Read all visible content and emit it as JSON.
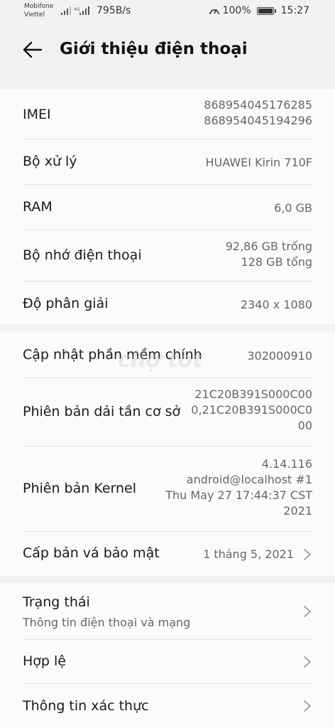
{
  "status_bar": {
    "carrier1": "Mobifone",
    "carrier2": "Viettel",
    "net_speed": "795B/s",
    "battery": "100%",
    "time": "15:27"
  },
  "header": {
    "title": "Giới thiệu điện thoại"
  },
  "section1": {
    "imei_label": "IMEI",
    "imei_value1": "868954045176285",
    "imei_value2": "868954045194296",
    "cpu_label": "Bộ xử lý",
    "cpu_value": "HUAWEI Kirin 710F",
    "ram_label": "RAM",
    "ram_value": "6,0 GB",
    "storage_label": "Bộ nhớ điện thoại",
    "storage_value1": "92,86  GB trống",
    "storage_value2": "128  GB tổng",
    "resolution_label": "Độ phân giải",
    "resolution_value": "2340 x 1080"
  },
  "section2": {
    "software_label": "Cập nhật phần mềm chính",
    "software_value": "302000910",
    "baseband_label": "Phiên bản dải tần cơ sở",
    "baseband_value1": "21C20B391S000C00",
    "baseband_value2": "0,21C20B391S000C0",
    "baseband_value3": "00",
    "kernel_label": "Phiên bản Kernel",
    "kernel_value1": "4.14.116",
    "kernel_value2": "android@localhost #1",
    "kernel_value3": "Thu May 27 17:44:37 CST",
    "kernel_value4": "2021",
    "patch_label": "Cấp bản vá bảo mật",
    "patch_value": "1 tháng 5, 2021"
  },
  "section3": {
    "status_label": "Trạng thái",
    "status_sub": "Thông tin điện thoại và mạng",
    "legal_label": "Hợp lệ",
    "cert_label": "Thông tin xác thực"
  },
  "icons": {
    "back": "arrow-left-icon",
    "chevron": "chevron-right-icon"
  }
}
